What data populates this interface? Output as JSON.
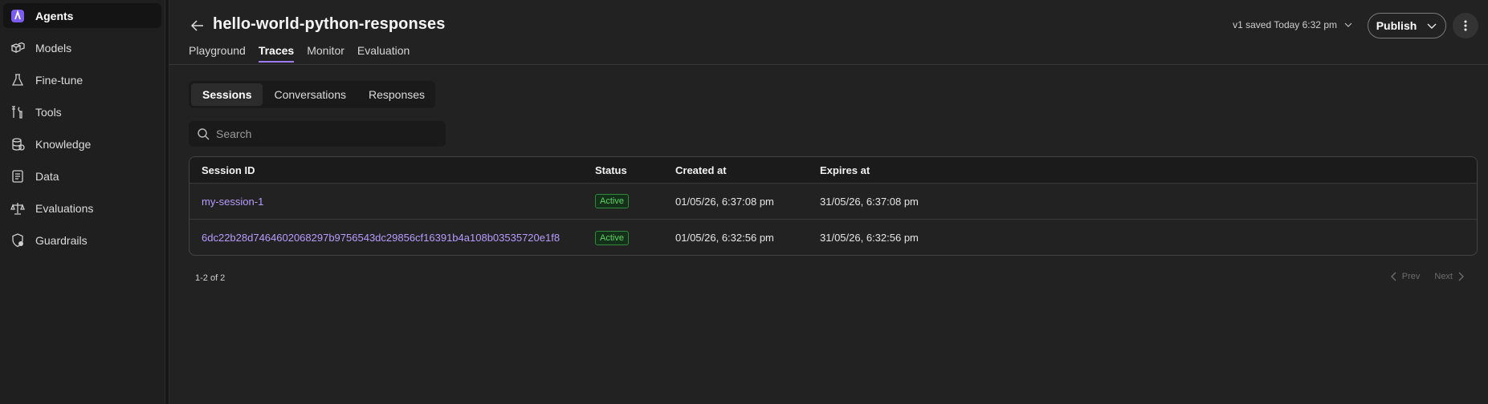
{
  "sidebar": {
    "items": [
      {
        "label": "Agents",
        "icon": "agents-logo-icon",
        "active": true
      },
      {
        "label": "Models",
        "icon": "cubes-icon"
      },
      {
        "label": "Fine-tune",
        "icon": "flask-icon"
      },
      {
        "label": "Tools",
        "icon": "tools-icon"
      },
      {
        "label": "Knowledge",
        "icon": "database-icon"
      },
      {
        "label": "Data",
        "icon": "document-icon"
      },
      {
        "label": "Evaluations",
        "icon": "scale-icon"
      },
      {
        "label": "Guardrails",
        "icon": "shield-icon"
      }
    ]
  },
  "header": {
    "title": "hello-world-python-responses",
    "version_text": "v1 saved Today 6:32 pm",
    "publish_label": "Publish",
    "tabs": [
      {
        "label": "Playground"
      },
      {
        "label": "Traces",
        "active": true
      },
      {
        "label": "Monitor"
      },
      {
        "label": "Evaluation"
      }
    ]
  },
  "segments": [
    {
      "label": "Sessions",
      "active": true
    },
    {
      "label": "Conversations"
    },
    {
      "label": "Responses"
    }
  ],
  "search": {
    "placeholder": "Search"
  },
  "table": {
    "columns": [
      "Session ID",
      "Status",
      "Created at",
      "Expires at"
    ],
    "rows": [
      {
        "id": "my-session-1",
        "status": "Active",
        "created": "01/05/26, 6:37:08 pm",
        "expires": "31/05/26, 6:37:08 pm"
      },
      {
        "id": "6dc22b28d7464602068297b9756543dc29856cf16391b4a108b03535720e1f8",
        "status": "Active",
        "created": "01/05/26, 6:32:56 pm",
        "expires": "31/05/26, 6:32:56 pm"
      }
    ]
  },
  "pagination": {
    "count": "1-2 of 2",
    "prev": "Prev",
    "next": "Next"
  },
  "colors": {
    "accent": "#9b7cf6",
    "link": "#b89cff",
    "badge_green": "#5fd16a",
    "background": "#222222"
  }
}
